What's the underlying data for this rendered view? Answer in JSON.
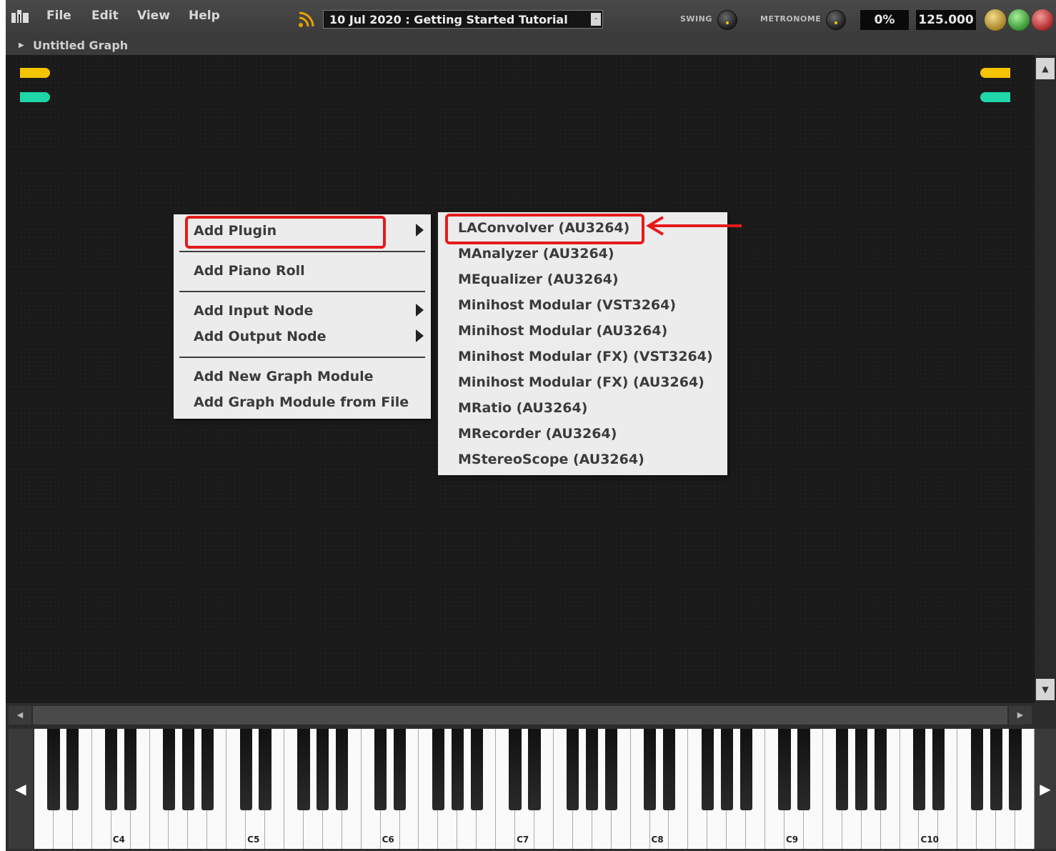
{
  "menubar": {
    "items": [
      "File",
      "Edit",
      "View",
      "Help"
    ]
  },
  "session": {
    "selected": "10 Jul 2020 : Getting Started Tutorial"
  },
  "transport": {
    "swing_label": "SWING",
    "metronome_label": "METRONOME",
    "percent": "0%",
    "tempo": "125.000"
  },
  "breadcrumb": {
    "title": "Untitled Graph"
  },
  "context_menu": {
    "items": [
      "Add Plugin",
      "Add Piano Roll",
      "Add Input Node",
      "Add Output Node",
      "Add New Graph Module",
      "Add Graph Module from File"
    ]
  },
  "plugin_submenu": {
    "items": [
      "LAConvolver (AU3264)",
      "MAnalyzer (AU3264)",
      "MEqualizer (AU3264)",
      "Minihost Modular (VST3264)",
      "Minihost Modular (AU3264)",
      "Minihost Modular (FX) (VST3264)",
      "Minihost Modular (FX) (AU3264)",
      "MRatio (AU3264)",
      "MRecorder (AU3264)",
      "MStereoScope (AU3264)"
    ]
  },
  "keyboard": {
    "octave_labels": [
      "C4",
      "C5",
      "C6",
      "C7",
      "C8",
      "C9",
      "C10"
    ]
  },
  "colors": {
    "highlight": "#e41b1b",
    "pill_yellow": "#f5c400",
    "pill_teal": "#1fd6a8"
  }
}
